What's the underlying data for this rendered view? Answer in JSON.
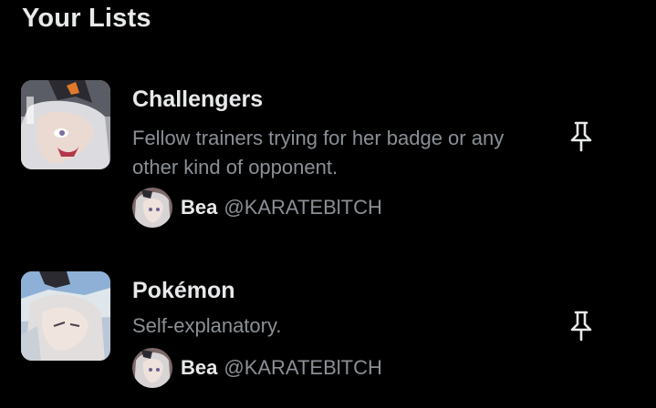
{
  "section": {
    "title": "Your Lists"
  },
  "lists": [
    {
      "name": "Challengers",
      "description": "Fellow trainers trying for her badge or any other kind of opponent.",
      "owner_name": "Bea",
      "owner_handle": "@KARATEBlTCH",
      "pin_icon": "pin-icon"
    },
    {
      "name": "Pokémon",
      "description": "Self-explanatory.",
      "owner_name": "Bea",
      "owner_handle": "@KARATEBlTCH",
      "pin_icon": "pin-icon"
    }
  ],
  "colors": {
    "background": "#000000",
    "primary_text": "#e7e9ea",
    "secondary_text": "#8b9096"
  }
}
